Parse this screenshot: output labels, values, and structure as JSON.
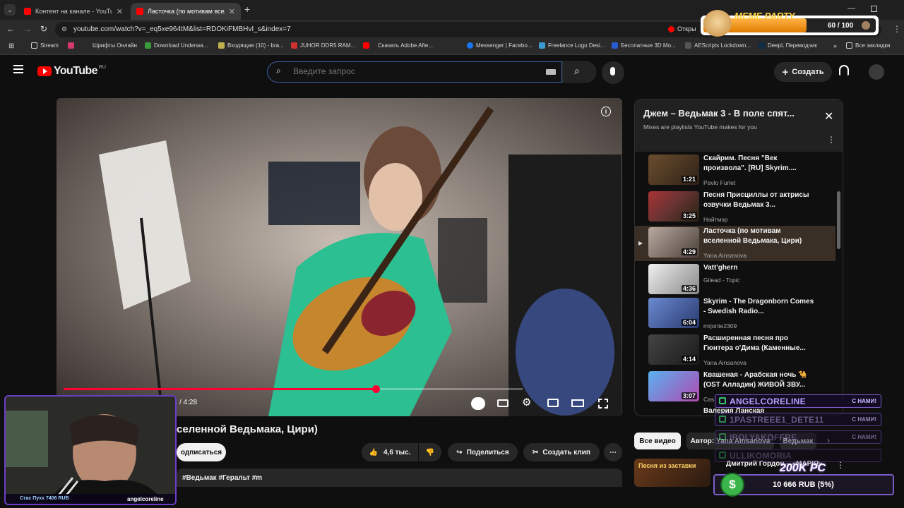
{
  "browser": {
    "tabs": [
      {
        "title": "Контент на канале - YouTube S"
      },
      {
        "title": "Ласточка (по мотивам вселе"
      }
    ],
    "url": "youtube.com/watch?v=_eq5xe964tM&list=RDOKiFMBHvI_s&index=7",
    "open_button": "Откры",
    "bookmarks": [
      "Stream",
      "Шрифты Онлайн",
      "Download Underwa...",
      "Входящие (10) - bra...",
      "JUHOR DDR5 RAM...",
      "Скачать Adobe Afte...",
      "Messenger | Facebo...",
      "Freelance Logo Desi...",
      "Бесплатные 3D Мо...",
      "AEScripts Lockdown...",
      "DeepL Переводчик",
      "Все закладки"
    ]
  },
  "youtube": {
    "logo": "YouTube",
    "logo_region": "RU",
    "search_placeholder": "Введите запрос",
    "create_label": "Создать"
  },
  "video": {
    "time_shown": "/ 4:28",
    "progress_fraction": 0.68,
    "title_visible": "селенной Ведьмака, Цири)",
    "subscribe_label": "одписаться",
    "likes": "4,6 тыс.",
    "share_label": "Поделиться",
    "clip_label": "Создать клип",
    "description_tags": "#Ведьмак #Геральт #m"
  },
  "playlist": {
    "title": "Джем – Ведьмак 3 - В поле спят...",
    "subtitle": "Mixes are playlists YouTube makes for you",
    "items": [
      {
        "title": "Скайрим. Песня \"Век произвола\". [RU] Skyrim....",
        "channel": "Pavlo Furlet",
        "duration": "1:21",
        "color": "#4b3a2a"
      },
      {
        "title": "Песня Присциллы от актрисы озвучки Ведьмак 3...",
        "channel": "Найтмэр",
        "duration": "3:25",
        "color": "#5a3030"
      },
      {
        "title": "Ласточка (по мотивам вселенной Ведьмака, Цири)",
        "channel": "Yana Ainsanova",
        "duration": "4:29",
        "color": "#6a5a50",
        "active": true
      },
      {
        "title": "Vatt'ghern",
        "channel": "Gilead - Topic",
        "duration": "4:36",
        "color": "#d9d9d9"
      },
      {
        "title": "Skyrim - The Dragonborn Comes - Swedish Radio...",
        "channel": "mrjonte2309",
        "duration": "6:04",
        "color": "#4a6aa0"
      },
      {
        "title": "Расширенная песня про Гюнтера о'Дима (Каменные...",
        "channel": "Yana Ainsanova",
        "duration": "4:14",
        "color": "#3a3a3a"
      },
      {
        "title": "Квашеная - Арабская ночь 🐪 (OST Алладин) ЖИВОЙ ЗВУ...",
        "channel": "Cas",
        "duration": "3:07",
        "color": "#3a6ab0"
      }
    ],
    "partial_next": "Валерия Ланская",
    "chips": [
      "Все видео",
      "Автор: Yana Ainsanova",
      "Ведьмак"
    ],
    "bottom_item_title": "Дмитрий Гордон – «МАРІЯ»",
    "bottom_thumb_text": "Песня из заставки"
  },
  "overlays": {
    "meme_party": {
      "label": "MEME PARTY",
      "counter": "60 / 100",
      "fill_fraction": 0.6
    },
    "webcam": {
      "name": "angelcoreline",
      "donor": "Стас Пухх 7406 RUB"
    },
    "chat": [
      {
        "name": "ANGELCORELINE",
        "suffix": "С НАМИ!",
        "color": "#b8a0ff"
      },
      {
        "name": "1PASTREEE1_DETE11",
        "suffix": "С НАМИ!",
        "color": "#6a5a9a"
      },
      {
        "name": "IPOLYAKOFFRE",
        "suffix": "С НАМИ!",
        "color": "#6a5a9a"
      },
      {
        "name": "ULLIKOMORIA",
        "suffix": "",
        "color": "#6a5a9a"
      }
    ],
    "donation": {
      "goal": "200K PC",
      "amount": "10 666 RUB (5%)"
    }
  }
}
